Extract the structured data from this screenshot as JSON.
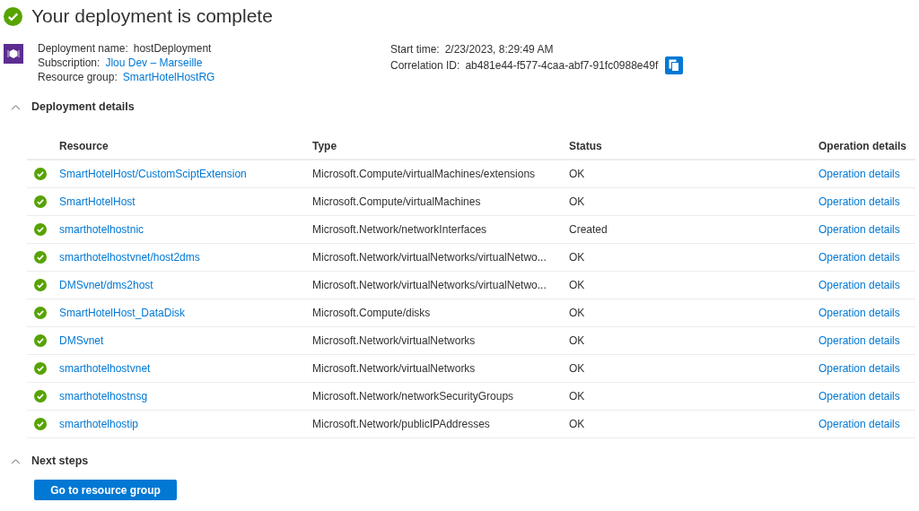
{
  "title": "Your deployment is complete",
  "info_left": [
    {
      "label": "Deployment name:",
      "value": "hostDeployment",
      "link": false
    },
    {
      "label": "Subscription:",
      "value": "Jlou Dev – Marseille",
      "link": true
    },
    {
      "label": "Resource group:",
      "value": "SmartHotelHostRG",
      "link": true
    }
  ],
  "info_right": [
    {
      "label": "Start time:",
      "value": "2/23/2023, 8:29:49 AM"
    },
    {
      "label": "Correlation ID:",
      "value": "ab481e44-f577-4caa-abf7-91fc0988e49f"
    }
  ],
  "deployment_details": {
    "title": "Deployment details",
    "expanded": true,
    "columns": [
      "Resource",
      "Type",
      "Status",
      "Operation details"
    ],
    "rows": [
      {
        "resource": "SmartHotelHost/CustomSciptExtension",
        "type": "Microsoft.Compute/virtualMachines/extensions",
        "status": "OK",
        "details": "Operation details"
      },
      {
        "resource": "SmartHotelHost",
        "type": "Microsoft.Compute/virtualMachines",
        "status": "OK",
        "details": "Operation details"
      },
      {
        "resource": "smarthotelhostnic",
        "type": "Microsoft.Network/networkInterfaces",
        "status": "Created",
        "details": "Operation details"
      },
      {
        "resource": "smarthotelhostvnet/host2dms",
        "type": "Microsoft.Network/virtualNetworks/virtualNetwo...",
        "status": "OK",
        "details": "Operation details"
      },
      {
        "resource": "DMSvnet/dms2host",
        "type": "Microsoft.Network/virtualNetworks/virtualNetwo...",
        "status": "OK",
        "details": "Operation details"
      },
      {
        "resource": "SmartHotelHost_DataDisk",
        "type": "Microsoft.Compute/disks",
        "status": "OK",
        "details": "Operation details"
      },
      {
        "resource": "DMSvnet",
        "type": "Microsoft.Network/virtualNetworks",
        "status": "OK",
        "details": "Operation details"
      },
      {
        "resource": "smarthotelhostvnet",
        "type": "Microsoft.Network/virtualNetworks",
        "status": "OK",
        "details": "Operation details"
      },
      {
        "resource": "smarthotelhostnsg",
        "type": "Microsoft.Network/networkSecurityGroups",
        "status": "OK",
        "details": "Operation details"
      },
      {
        "resource": "smarthotelhostip",
        "type": "Microsoft.Network/publicIPAddresses",
        "status": "OK",
        "details": "Operation details"
      }
    ]
  },
  "next_steps": {
    "title": "Next steps",
    "expanded": true,
    "button": "Go to resource group"
  }
}
